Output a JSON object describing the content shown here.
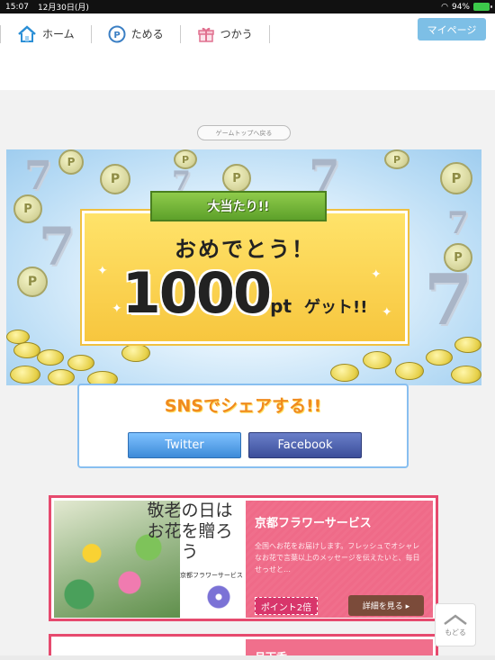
{
  "statusbar": {
    "time": "15:07",
    "date": "12月30日(月)",
    "battery": "94%"
  },
  "nav": {
    "items": [
      {
        "label": "ホーム",
        "icon": "home-icon"
      },
      {
        "label": "ためる",
        "icon": "point-coin-icon"
      },
      {
        "label": "つかう",
        "icon": "gift-icon"
      }
    ],
    "mypage": "マイページ"
  },
  "back_to_game_top": "ゲームトップへ戻る",
  "banner": {
    "ribbon": "大当たり!!",
    "congrats": "おめでとう！",
    "points": "1000",
    "unit": "pt",
    "get": "ゲット!!"
  },
  "share": {
    "title": "SNSでシェアする!!",
    "twitter": "Twitter",
    "facebook": "Facebook"
  },
  "offer": {
    "image_text": "敬老の日はお花を贈ろう",
    "image_shop": "京都フラワーサービス",
    "title": "京都フラワーサービス",
    "description": "全国へお花をお届けします。フレッシュでオシャレなお花で言葉以上のメッセージを伝えたいと、毎日せっせと…",
    "badge": "ポイント2倍",
    "detail": "詳細を見る ▸"
  },
  "offer2": {
    "title": "月下香"
  },
  "back_to_top": "もどる",
  "colors": {
    "accent_blue": "#7dbfe6",
    "offer_pink": "#e64a6e",
    "share_orange": "#f08b1d"
  }
}
